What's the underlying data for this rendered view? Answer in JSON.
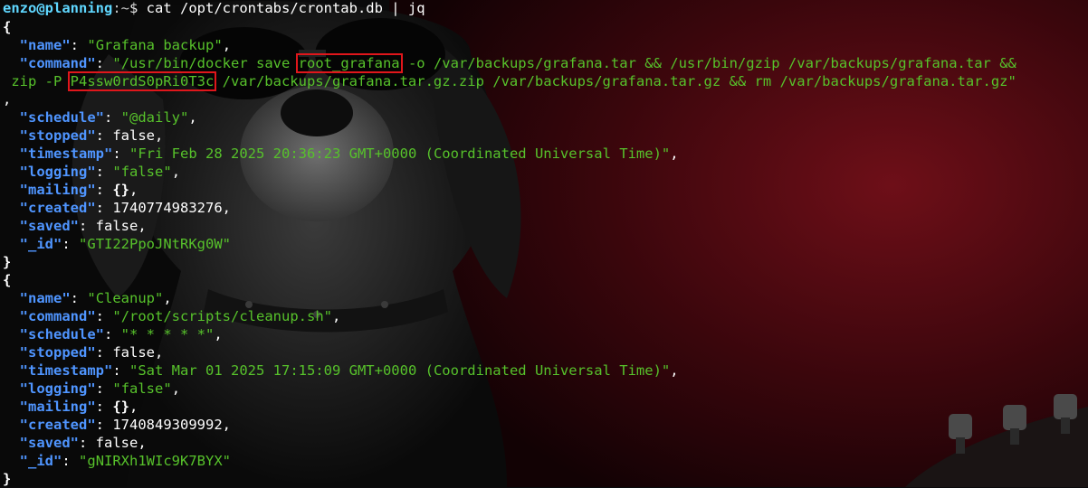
{
  "prompt": {
    "user": "enzo",
    "at": "@",
    "host": "planning",
    "path_segment": ":~",
    "symbol": "$",
    "command": " cat /opt/crontabs/crontab.db | jq"
  },
  "entries": [
    {
      "name": "Grafana backup",
      "command_part1": "/usr/bin/docker save ",
      "command_highlight1": "root_grafana",
      "command_part2": " -o /var/backups/grafana.tar && /usr/bin/gzip /var/backups/grafana.tar &&",
      "command_wrap_prefix": " zip -P ",
      "command_highlight2": "P4ssw0rdS0pRi0T3c",
      "command_part3": " /var/backups/grafana.tar.gz.zip /var/backups/grafana.tar.gz && rm /var/backups/grafana.tar.gz\"",
      "schedule": "@daily",
      "stopped": "false",
      "timestamp": "Fri Feb 28 2025 20:36:23 GMT+0000 (Coordinated Universal Time)",
      "logging": "false",
      "mailing": "{}",
      "created": "1740774983276",
      "saved": "false",
      "_id": "GTI22PpoJNtRKg0W"
    },
    {
      "name": "Cleanup",
      "command": "/root/scripts/cleanup.sh",
      "schedule": "* * * * *",
      "stopped": "false",
      "timestamp": "Sat Mar 01 2025 17:15:09 GMT+0000 (Coordinated Universal Time)",
      "logging": "false",
      "mailing": "{}",
      "created": "1740849309992",
      "saved": "false",
      "_id": "gNIRXh1WIc9K7BYX"
    }
  ],
  "json_keys": {
    "name": "\"name\"",
    "command": "\"command\"",
    "schedule": "\"schedule\"",
    "stopped": "\"stopped\"",
    "timestamp": "\"timestamp\"",
    "logging": "\"logging\"",
    "mailing": "\"mailing\"",
    "created": "\"created\"",
    "saved": "\"saved\"",
    "_id": "\"_id\""
  },
  "colors": {
    "highlight_box": "#e0161b",
    "json_key": "#4f95ff",
    "json_string": "#57c22b",
    "prompt": "#5fd7ff",
    "wallpaper_red": "#6b0d14"
  },
  "icons": {
    "wallpaper": "dog-with-sunglasses-and-guitar-wallpaper"
  }
}
